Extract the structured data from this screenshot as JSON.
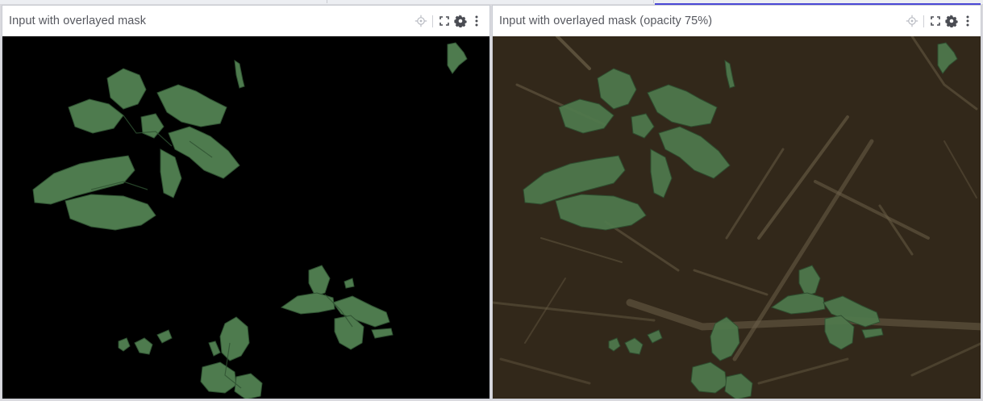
{
  "panels": [
    {
      "title": "Input with overlayed mask",
      "toolbar": [
        "crosshair-icon",
        "fullscreen-icon",
        "gear-icon",
        "more-vertical-icon"
      ]
    },
    {
      "title": "Input with overlayed mask (opacity 75%)",
      "toolbar": [
        "crosshair-icon",
        "fullscreen-icon",
        "gear-icon",
        "more-vertical-icon"
      ]
    }
  ],
  "colors": {
    "mask_background": "#000000",
    "leaf": "#4e7b4e",
    "leaf_dark": "#2f5232",
    "soil": "#2f2518",
    "straw": "#6b5f48"
  }
}
